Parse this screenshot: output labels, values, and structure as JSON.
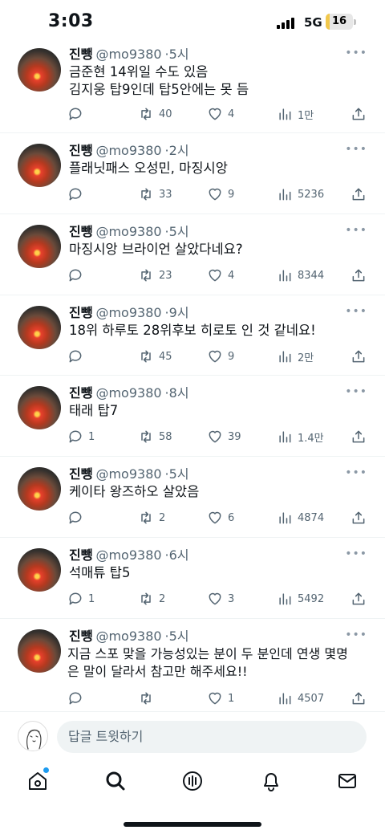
{
  "status_bar": {
    "time": "3:03",
    "network": "5G",
    "battery": "16",
    "battery_level": 0.16
  },
  "tweets": [
    {
      "name": "진뺑",
      "handle": "@mo9380",
      "time": "5시",
      "lines": [
        "금준현 14위일 수도 있음",
        "김지웅 탑9인데 탑5안에는 못 듬"
      ],
      "replies": "",
      "retweets": "40",
      "likes": "4",
      "views": "1만"
    },
    {
      "name": "진뺑",
      "handle": "@mo9380",
      "time": "2시",
      "lines": [
        "플래닛패스 오성민, 마징시앙"
      ],
      "replies": "",
      "retweets": "33",
      "likes": "9",
      "views": "5236"
    },
    {
      "name": "진뺑",
      "handle": "@mo9380",
      "time": "5시",
      "lines": [
        "마징시앙 브라이언 살았다네요?"
      ],
      "replies": "",
      "retweets": "23",
      "likes": "4",
      "views": "8344"
    },
    {
      "name": "진뺑",
      "handle": "@mo9380",
      "time": "9시",
      "lines": [
        "18위 하루토 28위후보 히로토 인 것 같네요!"
      ],
      "replies": "",
      "retweets": "45",
      "likes": "9",
      "views": "2만"
    },
    {
      "name": "진뺑",
      "handle": "@mo9380",
      "time": "8시",
      "lines": [
        "태래 탑7"
      ],
      "replies": "1",
      "retweets": "58",
      "likes": "39",
      "views": "1.4만"
    },
    {
      "name": "진뺑",
      "handle": "@mo9380",
      "time": "5시",
      "lines": [
        "케이타 왕즈하오 살았음"
      ],
      "replies": "",
      "retweets": "2",
      "likes": "6",
      "views": "4874"
    },
    {
      "name": "진뺑",
      "handle": "@mo9380",
      "time": "6시",
      "lines": [
        "석매튜 탑5"
      ],
      "replies": "1",
      "retweets": "2",
      "likes": "3",
      "views": "5492"
    },
    {
      "name": "진뺑",
      "handle": "@mo9380",
      "time": "5시",
      "lines": [
        "지금 스포 맞을 가능성있는 분이 두 분인데 연생 몇명",
        "은 말이 달라서 참고만 해주세요!!"
      ],
      "replies": "",
      "retweets": "",
      "likes": "1",
      "views": "4507"
    }
  ],
  "reply_bar": {
    "placeholder": "답글 트윗하기"
  },
  "tabbar": {
    "items": [
      "home-icon",
      "search-icon",
      "spaces-icon",
      "notifications-icon",
      "messages-icon"
    ]
  },
  "colors": {
    "accent": "#1d9bf0",
    "text": "#0f1419",
    "muted": "#536471"
  }
}
